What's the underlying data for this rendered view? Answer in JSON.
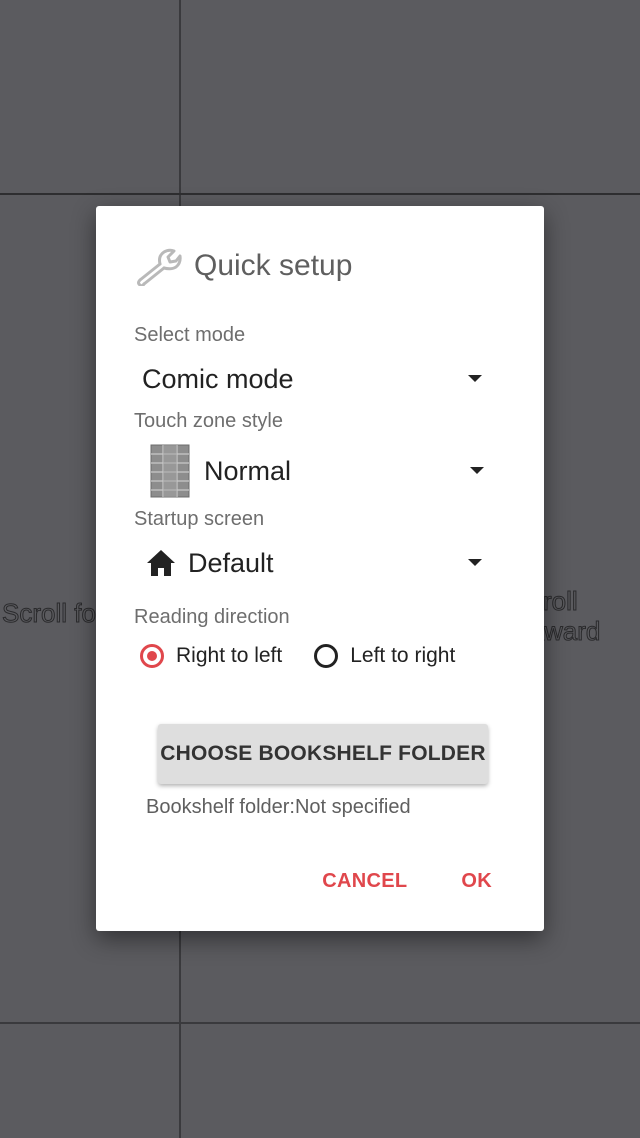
{
  "background": {
    "left_zone_label": "Scroll fo",
    "right_zone_label_line1": "croll",
    "right_zone_label_line2": "ckward"
  },
  "dialog": {
    "title": "Quick setup",
    "title_icon": "wrench-icon",
    "select_mode": {
      "label": "Select mode",
      "value": "Comic mode"
    },
    "touch_zone_style": {
      "label": "Touch zone style",
      "value": "Normal",
      "icon": "touch-zone-grid-icon"
    },
    "startup_screen": {
      "label": "Startup screen",
      "value": "Default",
      "icon": "home-icon"
    },
    "reading_direction": {
      "label": "Reading direction",
      "options": [
        "Right to left",
        "Left to right"
      ],
      "selected": "Right to left"
    },
    "choose_folder_label": "CHOOSE BOOKSHELF FOLDER",
    "folder_status": "Bookshelf folder:Not specified",
    "cancel_label": "CANCEL",
    "ok_label": "OK"
  },
  "colors": {
    "accent": "#e0474c",
    "scrim": "#5b5b5f",
    "dialog_bg": "#ffffff"
  }
}
